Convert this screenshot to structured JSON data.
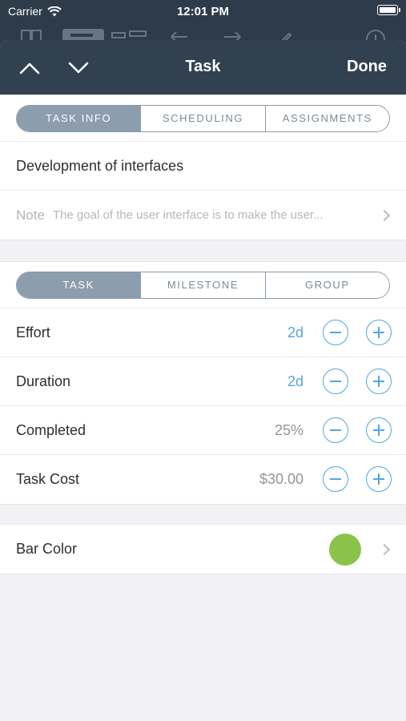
{
  "status_bar": {
    "carrier": "Carrier",
    "time": "12:01 PM"
  },
  "nav": {
    "title": "Task",
    "done_label": "Done",
    "prev_icon": "chevron-up-icon",
    "next_icon": "chevron-down-icon"
  },
  "info_tabs": [
    {
      "label": "TASK INFO",
      "active": true
    },
    {
      "label": "SCHEDULING",
      "active": false
    },
    {
      "label": "ASSIGNMENTS",
      "active": false
    }
  ],
  "task": {
    "name": "Development of interfaces",
    "note_label": "Note",
    "note_text": "The goal of the user interface is to make the user..."
  },
  "type_tabs": [
    {
      "label": "TASK",
      "active": true
    },
    {
      "label": "MILESTONE",
      "active": false
    },
    {
      "label": "GROUP",
      "active": false
    }
  ],
  "fields": [
    {
      "label": "Effort",
      "value": "2d",
      "style": "blue"
    },
    {
      "label": "Duration",
      "value": "2d",
      "style": "blue"
    },
    {
      "label": "Completed",
      "value": "25%",
      "style": "gray"
    },
    {
      "label": "Task Cost",
      "value": "$30.00",
      "style": "gray"
    }
  ],
  "bar_color": {
    "label": "Bar Color",
    "color": "#8bc34a"
  },
  "colors": {
    "accent": "#4fa6de",
    "navbar": "#324150",
    "segment_active": "#8c9dad"
  }
}
